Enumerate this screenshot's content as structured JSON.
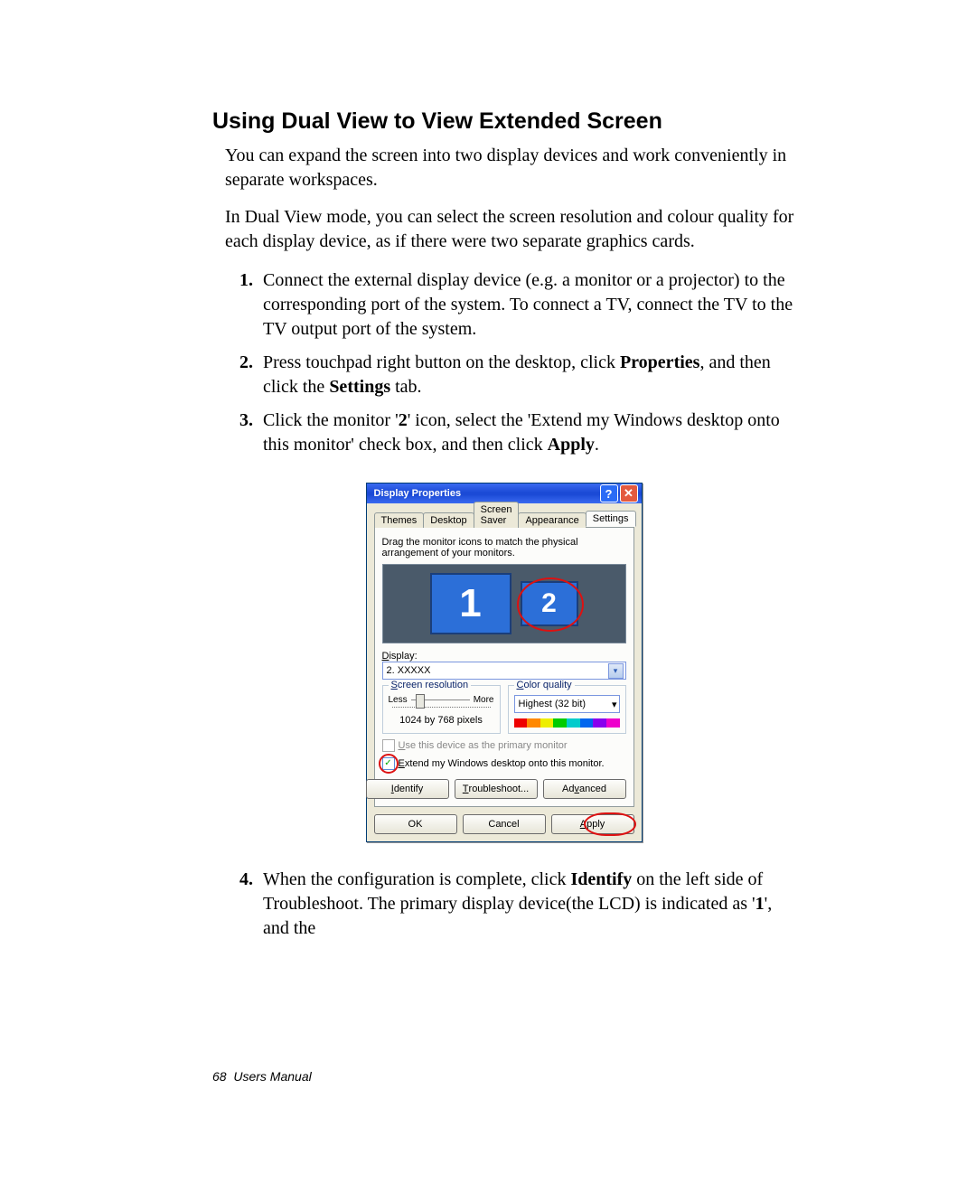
{
  "page": {
    "heading": "Using Dual View to View Extended Screen",
    "intro1": "You can expand the screen into two display devices and work conveniently in separate workspaces.",
    "intro2": "In Dual View mode, you can select the screen resolution and colour quality for each display device, as if there were two separate graphics cards."
  },
  "steps": {
    "s1": "Connect the external display device (e.g. a monitor or a projector) to the corresponding port of the system. To connect a TV, connect the TV to the TV output port of the system.",
    "s2a": "Press touchpad right button on the desktop, click ",
    "s2b": "Properties",
    "s2c": ", and then click the ",
    "s2d": "Settings",
    "s2e": " tab.",
    "s3a": "Click the monitor '",
    "s3b": "2",
    "s3c": "' icon, select the 'Extend my Windows desktop onto this monitor' check box, and then click ",
    "s3d": "Apply",
    "s3e": ".",
    "s4a": "When the configuration is complete, click ",
    "s4b": "Identify",
    "s4c": " on the left side of Troubleshoot. The primary display device(the LCD) is indicated as '",
    "s4d": "1",
    "s4e": "', and the"
  },
  "dialog": {
    "title": "Display Properties",
    "tabs": [
      "Themes",
      "Desktop",
      "Screen Saver",
      "Appearance",
      "Settings"
    ],
    "hint": "Drag the monitor icons to match the physical arrangement of your monitors.",
    "mon1": "1",
    "mon2": "2",
    "display_label_u": "D",
    "display_label_rest": "isplay:",
    "display_value": "2. XXXXX",
    "res_label_u": "S",
    "res_label_rest": "creen resolution",
    "res_less": "Less",
    "res_more": "More",
    "res_value": "1024 by 768 pixels",
    "cq_label_u": "C",
    "cq_label_rest": "olor quality",
    "cq_value": "Highest (32 bit)",
    "primary_u": "U",
    "primary_rest": "se this device as the primary monitor",
    "extend_u": "E",
    "extend_rest": "xtend my Windows desktop onto this monitor.",
    "btn_identify_u": "I",
    "btn_identify_rest": "dentify",
    "btn_troubleshoot_u": "T",
    "btn_troubleshoot_rest": "roubleshoot...",
    "btn_advanced_pre": "Ad",
    "btn_advanced_u": "v",
    "btn_advanced_rest": "anced",
    "btn_ok": "OK",
    "btn_cancel": "Cancel",
    "btn_apply_u": "A",
    "btn_apply_rest": "pply"
  },
  "footer": {
    "page_number": "68",
    "label": "Users Manual"
  }
}
